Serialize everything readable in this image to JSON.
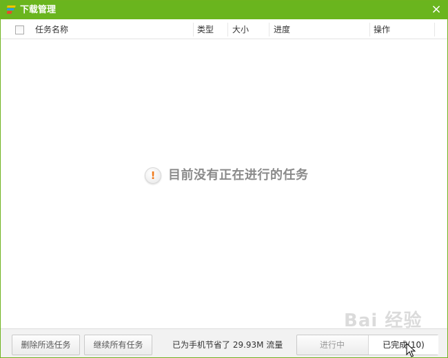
{
  "window": {
    "title": "下载管理",
    "close_label": "×",
    "accent_color": "#6ab51e"
  },
  "table": {
    "columns": [
      "任务名称",
      "类型",
      "大小",
      "进度",
      "操作"
    ],
    "rows": []
  },
  "empty_state": {
    "icon": "exclamation-icon",
    "symbol": "!",
    "message": "目前没有正在进行的任务"
  },
  "footer": {
    "delete_selected_label": "删除所选任务",
    "resume_all_label": "继续所有任务",
    "saved_data_text": "已为手机节省了 29.93M 流量",
    "tabs": [
      {
        "label": "进行中",
        "active": false
      },
      {
        "label": "已完成(10)",
        "active": true
      }
    ]
  },
  "watermark": {
    "text": "Bai 经验"
  }
}
